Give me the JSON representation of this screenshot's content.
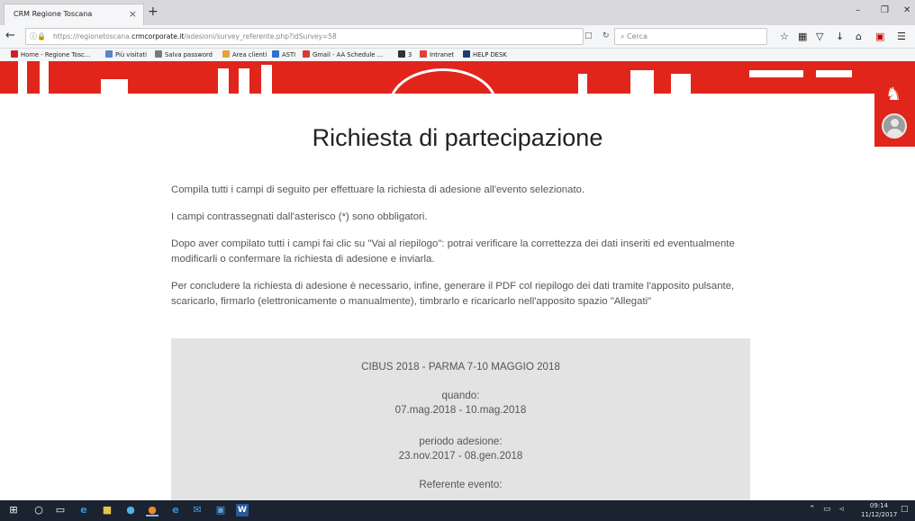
{
  "browser": {
    "tab_title": "CRM Regione Toscana",
    "tab_close": "×",
    "new_tab": "+",
    "window_minimize": "–",
    "window_restore": "❐",
    "window_close": "✕",
    "url_prefix": "https://regionetoscana.",
    "url_domain": "crmcorporate.it",
    "url_path": "/adesioni/survey_referente.php?idSurvey=58",
    "search_placeholder": "Cerca",
    "icons": [
      "back-icon",
      "info-icon",
      "lock-icon",
      "reader-icon",
      "reload-icon",
      "search-icon",
      "star-icon",
      "library-icon",
      "pocket-icon",
      "download-icon",
      "home-icon",
      "pdf-icon",
      "menu-icon"
    ]
  },
  "bookmarks": [
    {
      "label": "Home - Regione Tosc...",
      "color": "#d21f26"
    },
    {
      "label": "Più visitati",
      "color": "#5a86c7"
    },
    {
      "label": "Salva password",
      "color": "#7a7a7a"
    },
    {
      "label": "Area clienti",
      "color": "#e5a13a"
    },
    {
      "label": "ASTI",
      "color": "#2d6fd2"
    },
    {
      "label": "Gmail - AA Schedule ...",
      "color": "#d93b2f"
    },
    {
      "label": "3",
      "color": "#333333"
    },
    {
      "label": "Intranet",
      "color": "#e04040"
    },
    {
      "label": "HELP DESK",
      "color": "#1f3b73"
    }
  ],
  "page": {
    "title": "Richiesta di partecipazione",
    "paragraphs": [
      "Compila tutti i campi di seguito per effettuare la richiesta di adesione all'evento selezionato.",
      "I campi contrassegnati dall'asterisco (*) sono obbligatori.",
      "Dopo aver compilato tutti i campi fai clic su \"Vai al riepilogo\": potrai verificare la correttezza dei dati inseriti ed eventualmente modificarli o confermare la richiesta di adesione e inviarla.",
      "Per concludere la richiesta di adesione è necessario, infine, generare il PDF col riepilogo dei dati tramite l'apposito pulsante, scaricarlo, firmarlo (elettronicamente o manualmente), timbrarlo e ricaricarlo nell'apposito spazio \"Allegati\""
    ],
    "event": {
      "name": "CIBUS 2018 - PARMA 7-10 MAGGIO 2018",
      "when_label": "quando:",
      "when_value": "07.mag.2018 - 10.mag.2018",
      "period_label": "periodo adesione:",
      "period_value": "23.nov.2017 - 08.gen.2018",
      "referent_label": "Referente evento:"
    }
  },
  "colors": {
    "brand_red": "#e1251b",
    "taskbar": "#1b2331"
  },
  "taskbar": {
    "clock_time": "09:14",
    "clock_date": "11/12/2017"
  }
}
